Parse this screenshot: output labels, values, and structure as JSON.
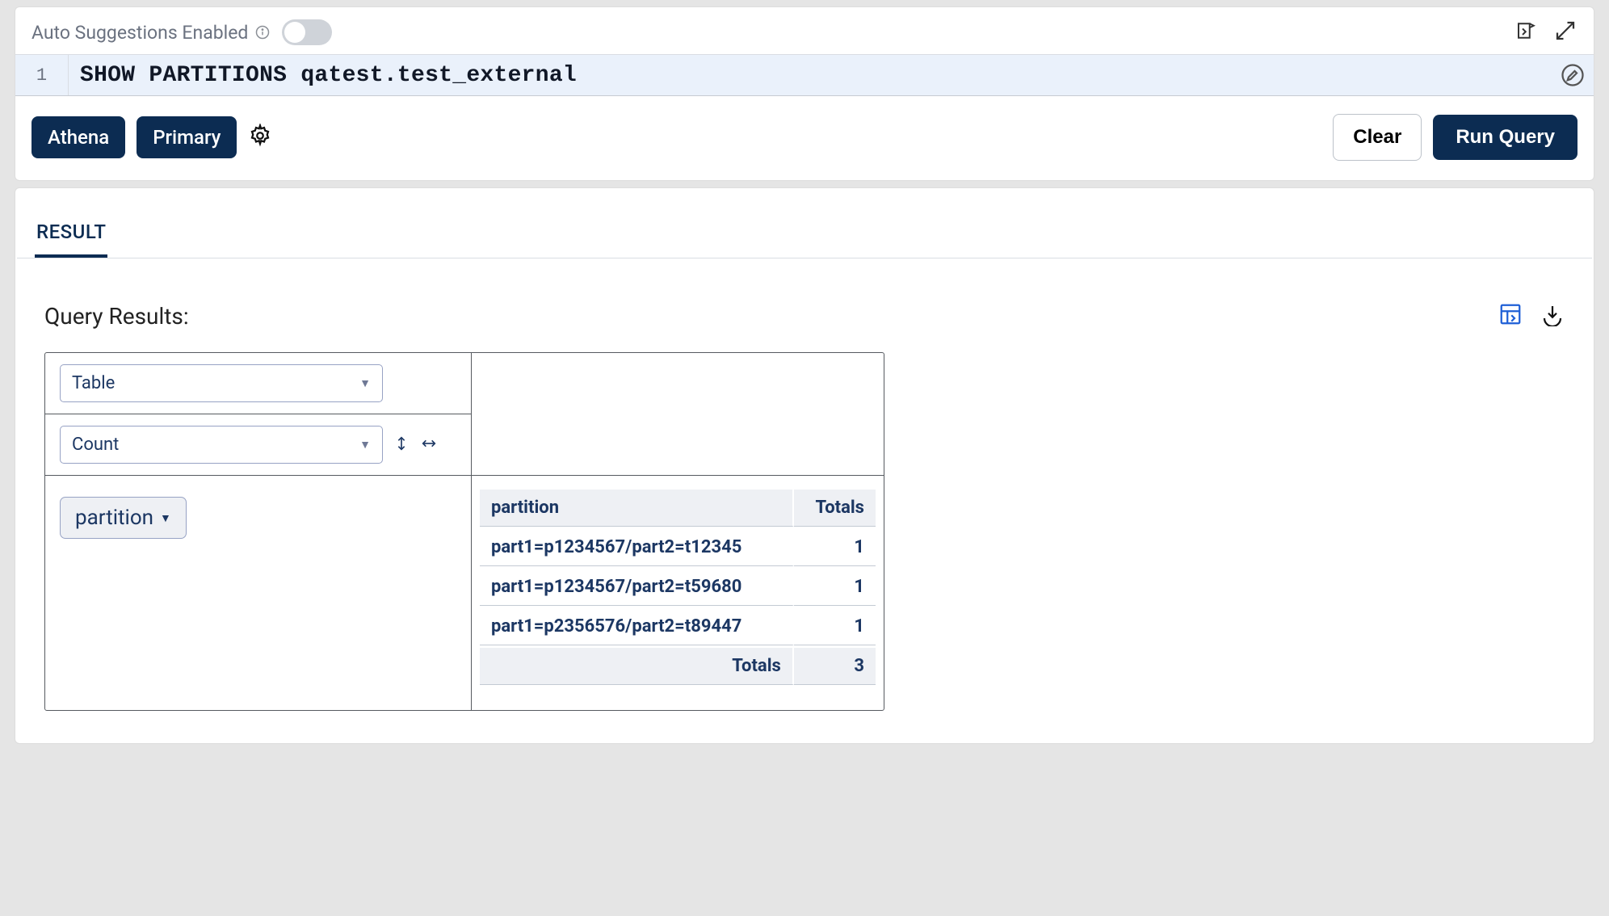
{
  "toggle": {
    "label": "Auto Suggestions Enabled",
    "enabled": false
  },
  "editor": {
    "line_number": "1",
    "query": "SHOW PARTITIONS qatest.test_external"
  },
  "context": {
    "engine": "Athena",
    "workgroup": "Primary"
  },
  "actions": {
    "clear": "Clear",
    "run": "Run Query"
  },
  "tabs": {
    "result": "RESULT"
  },
  "results": {
    "heading": "Query Results:",
    "view_select": "Table",
    "agg_select": "Count",
    "groupby_chip": "partition"
  },
  "table": {
    "headers": {
      "partition": "partition",
      "totals": "Totals"
    },
    "rows": [
      {
        "partition": "part1=p1234567/part2=t12345",
        "count": "1"
      },
      {
        "partition": "part1=p1234567/part2=t59680",
        "count": "1"
      },
      {
        "partition": "part1=p2356576/part2=t89447",
        "count": "1"
      }
    ],
    "footer": {
      "label": "Totals",
      "value": "3"
    }
  }
}
